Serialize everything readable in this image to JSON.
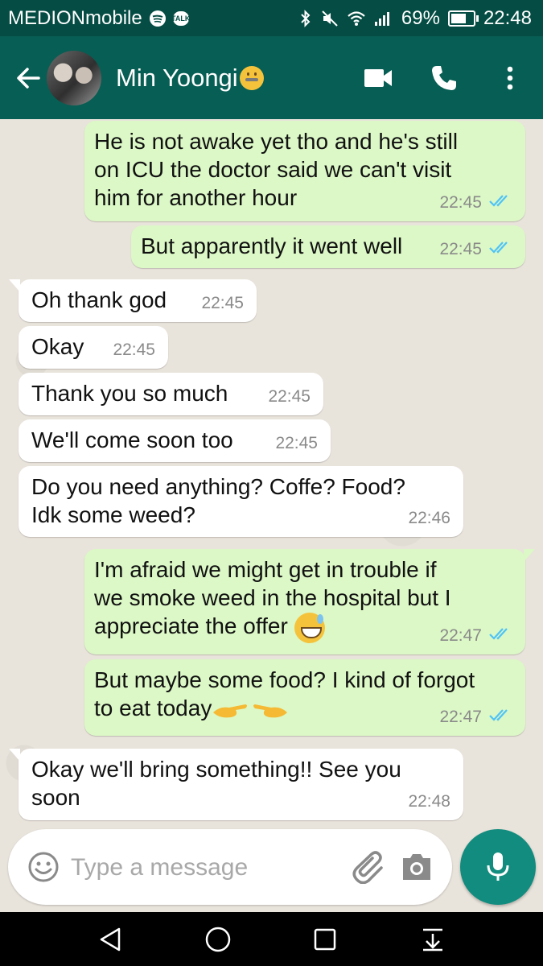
{
  "status_bar": {
    "carrier": "MEDIONmobile",
    "battery": "69%",
    "battery_level": 0.69,
    "time": "22:48",
    "left_icons": [
      "spotify-icon",
      "talk-icon"
    ],
    "right_icons": [
      "bluetooth-icon",
      "mute-icon",
      "wifi-icon",
      "signal-icon",
      "battery-icon"
    ],
    "talk_badge": "TALK"
  },
  "header": {
    "contact_name": "Min Yoongi",
    "name_emoji": "zipper-mouth-face",
    "actions": [
      "video-call-icon",
      "voice-call-icon",
      "more-options-icon"
    ]
  },
  "messages": [
    {
      "dir": "out",
      "lines": [
        "He is not awake yet tho and he's still",
        "on ICU the doctor said we can't visit",
        "him for another hour"
      ],
      "time": "22:45",
      "read": true
    },
    {
      "dir": "out",
      "lines": [
        "But apparently it went well"
      ],
      "time": "22:45",
      "read": true
    },
    {
      "dir": "in",
      "lines": [
        "Oh thank god"
      ],
      "time": "22:45"
    },
    {
      "dir": "in",
      "lines": [
        "Okay"
      ],
      "time": "22:45"
    },
    {
      "dir": "in",
      "lines": [
        "Thank you so much"
      ],
      "time": "22:45"
    },
    {
      "dir": "in",
      "lines": [
        "We'll come soon too"
      ],
      "time": "22:45"
    },
    {
      "dir": "in",
      "lines": [
        "Do you need anything? Coffe? Food?",
        "Idk some weed?"
      ],
      "time": "22:46"
    },
    {
      "dir": "out",
      "lines": [
        "I'm afraid we might get in trouble if",
        "we smoke weed in the hospital but I",
        "appreciate the offer"
      ],
      "time": "22:47",
      "read": true,
      "emoji": "grinning-sweat-face"
    },
    {
      "dir": "out",
      "lines": [
        "But maybe some food? I kind of forgot",
        "to eat today"
      ],
      "time": "22:47",
      "read": true,
      "emoji": "pointing-fingers"
    },
    {
      "dir": "in",
      "lines": [
        "Okay we'll bring something!! See you",
        "soon"
      ],
      "time": "22:48"
    }
  ],
  "composer": {
    "placeholder": "Type a message",
    "value": ""
  },
  "colors": {
    "header": "#075e54",
    "status_bar": "#054d44",
    "outgoing_bubble": "#dcf8c6",
    "incoming_bubble": "#ffffff",
    "read_ticks": "#4fc3f7",
    "mic_button": "#128c7e"
  }
}
